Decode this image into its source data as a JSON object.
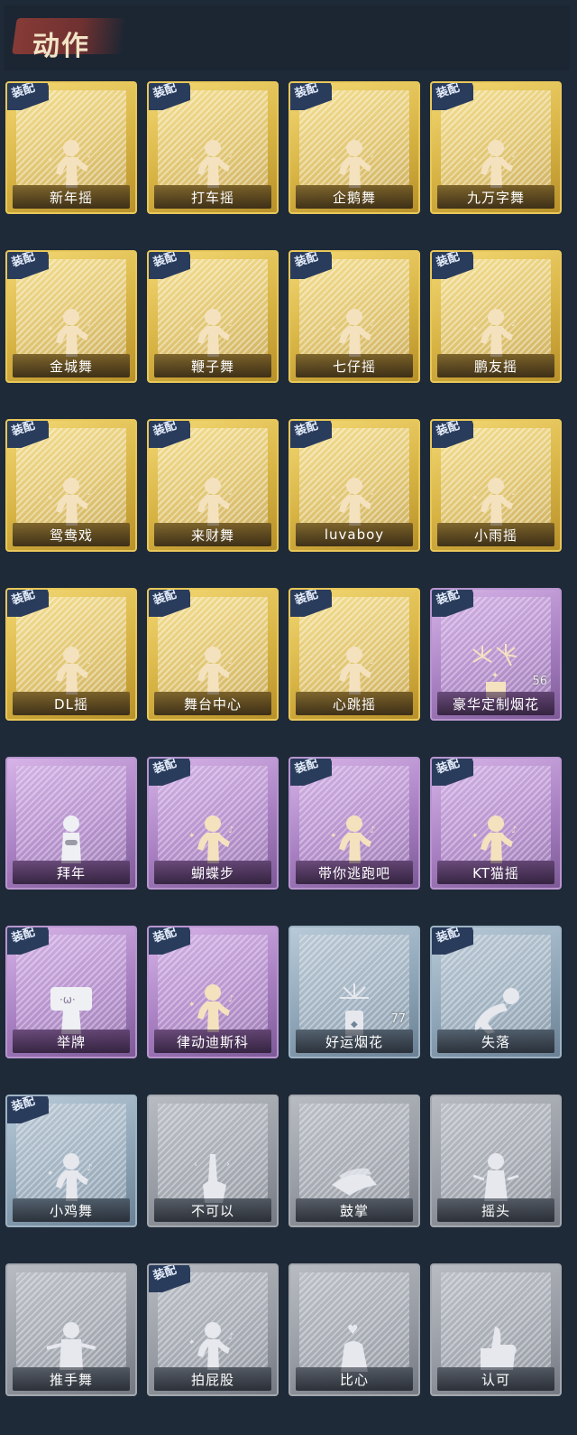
{
  "header": {
    "title": "动作"
  },
  "badge_label": "装配",
  "items": [
    {
      "label": "新年摇",
      "equipped": true,
      "tone": "gold",
      "icon": "dance-pose-icon"
    },
    {
      "label": "打车摇",
      "equipped": true,
      "tone": "gold",
      "icon": "dance-pose-icon"
    },
    {
      "label": "企鹅舞",
      "equipped": true,
      "tone": "gold",
      "icon": "dance-pose-icon"
    },
    {
      "label": "九万字舞",
      "equipped": true,
      "tone": "gold",
      "icon": "dance-pose-icon"
    },
    {
      "label": "金城舞",
      "equipped": true,
      "tone": "gold",
      "icon": "dance-pose-icon"
    },
    {
      "label": "鞭子舞",
      "equipped": true,
      "tone": "gold",
      "icon": "dance-pose-icon"
    },
    {
      "label": "七仔摇",
      "equipped": true,
      "tone": "gold",
      "icon": "dance-pose-icon"
    },
    {
      "label": "鹏友摇",
      "equipped": true,
      "tone": "gold",
      "icon": "dance-pose-icon"
    },
    {
      "label": "鸳鸯戏",
      "equipped": true,
      "tone": "gold",
      "icon": "dance-pose-icon"
    },
    {
      "label": "来财舞",
      "equipped": true,
      "tone": "gold",
      "icon": "dance-pose-icon"
    },
    {
      "label": "luvaboy",
      "equipped": true,
      "tone": "gold",
      "icon": "dance-pose-icon"
    },
    {
      "label": "小雨摇",
      "equipped": true,
      "tone": "gold",
      "icon": "dance-pose-icon"
    },
    {
      "label": "DL摇",
      "equipped": true,
      "tone": "gold",
      "icon": "dance-pose-icon"
    },
    {
      "label": "舞台中心",
      "equipped": true,
      "tone": "gold",
      "icon": "dance-pose-icon"
    },
    {
      "label": "心跳摇",
      "equipped": true,
      "tone": "gold",
      "icon": "dance-pose-icon"
    },
    {
      "label": "豪华定制烟花",
      "equipped": true,
      "tone": "purple",
      "icon": "fireworks-icon",
      "count": "56"
    },
    {
      "label": "拜年",
      "equipped": false,
      "tone": "purple",
      "light": true,
      "icon": "bow-pose-icon"
    },
    {
      "label": "蝴蝶步",
      "equipped": true,
      "tone": "purple",
      "icon": "dance-pose-icon"
    },
    {
      "label": "带你逃跑吧",
      "equipped": true,
      "tone": "purple",
      "icon": "dance-pose-icon"
    },
    {
      "label": "KT猫摇",
      "equipped": true,
      "tone": "purple",
      "icon": "dance-pose-icon"
    },
    {
      "label": "举牌",
      "equipped": true,
      "tone": "purple",
      "light": true,
      "icon": "sign-hold-icon"
    },
    {
      "label": "律动迪斯科",
      "equipped": true,
      "tone": "purple",
      "icon": "dance-pose-icon"
    },
    {
      "label": "好运烟花",
      "equipped": false,
      "tone": "blue",
      "icon": "firework-can-icon",
      "count": "77"
    },
    {
      "label": "失落",
      "equipped": true,
      "tone": "blue",
      "icon": "crawl-pose-icon"
    },
    {
      "label": "小鸡舞",
      "equipped": true,
      "tone": "blue",
      "icon": "dance-pose-icon"
    },
    {
      "label": "不可以",
      "equipped": false,
      "tone": "gray",
      "icon": "finger-wag-icon"
    },
    {
      "label": "鼓掌",
      "equipped": false,
      "tone": "gray",
      "icon": "clap-hands-icon"
    },
    {
      "label": "摇头",
      "equipped": false,
      "tone": "gray",
      "icon": "head-shake-icon"
    },
    {
      "label": "推手舞",
      "equipped": false,
      "tone": "gray",
      "icon": "push-pose-icon"
    },
    {
      "label": "拍屁股",
      "equipped": true,
      "tone": "gray",
      "icon": "dance-pose-icon"
    },
    {
      "label": "比心",
      "equipped": false,
      "tone": "gray",
      "icon": "heart-hands-icon"
    },
    {
      "label": "认可",
      "equipped": false,
      "tone": "gray",
      "icon": "thumbs-up-icon"
    }
  ]
}
